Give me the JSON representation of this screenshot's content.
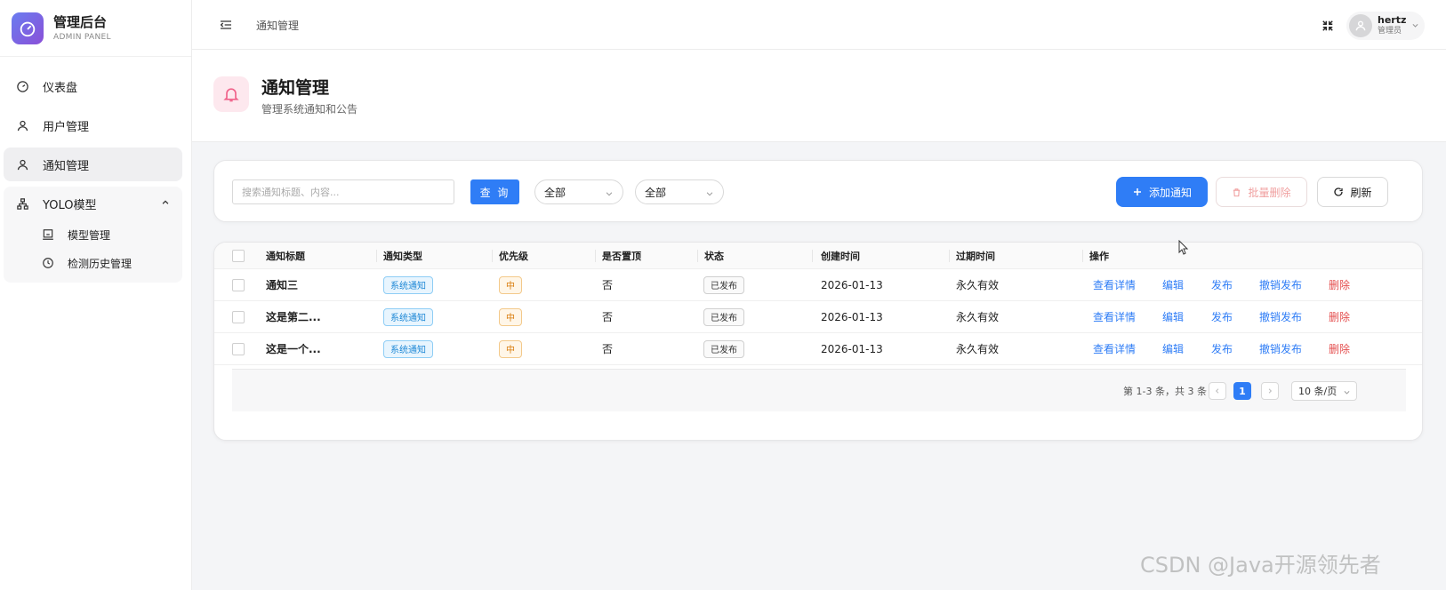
{
  "brand": {
    "title": "管理后台",
    "subtitle": "ADMIN PANEL"
  },
  "sidebar": {
    "items": [
      {
        "label": "仪表盘",
        "icon": "dashboard-icon"
      },
      {
        "label": "用户管理",
        "icon": "user-icon"
      },
      {
        "label": "通知管理",
        "icon": "user-icon",
        "active": true
      }
    ],
    "group": {
      "label": "YOLO模型",
      "icon": "sitemap-icon",
      "expanded": true,
      "children": [
        {
          "label": "模型管理",
          "icon": "model-icon"
        },
        {
          "label": "检测历史管理",
          "icon": "history-icon"
        }
      ]
    }
  },
  "header": {
    "breadcrumb": "通知管理",
    "user": {
      "name": "hertz",
      "role": "管理员"
    }
  },
  "page": {
    "title": "通知管理",
    "subtitle": "管理系统通知和公告"
  },
  "filters": {
    "search_placeholder": "搜索通知标题、内容...",
    "query_label": "查 询",
    "select1": "全部",
    "select2": "全部",
    "add_label": "添加通知",
    "batch_delete_label": "批量删除",
    "refresh_label": "刷新"
  },
  "table": {
    "columns": [
      "通知标题",
      "通知类型",
      "优先级",
      "是否置顶",
      "状态",
      "创建时间",
      "过期时间",
      "操作"
    ],
    "rows": [
      {
        "title": "通知三",
        "type": "系统通知",
        "priority": "中",
        "pinned": "否",
        "status": "已发布",
        "created": "2026-01-13",
        "expires": "永久有效"
      },
      {
        "title": "这是第二...",
        "type": "系统通知",
        "priority": "中",
        "pinned": "否",
        "status": "已发布",
        "created": "2026-01-13",
        "expires": "永久有效"
      },
      {
        "title": "这是一个...",
        "type": "系统通知",
        "priority": "中",
        "pinned": "否",
        "status": "已发布",
        "created": "2026-01-13",
        "expires": "永久有效"
      }
    ],
    "actions": {
      "view": "查看详情",
      "edit": "编辑",
      "publish": "发布",
      "unpublish": "撤销发布",
      "delete": "删除"
    }
  },
  "pagination": {
    "total_text": "第 1-3 条，共 3 条",
    "current": "1",
    "page_size": "10 条/页"
  },
  "watermark": "CSDN @Java开源领先者",
  "colors": {
    "primary": "#2f7df6",
    "danger": "#e44f4f"
  }
}
